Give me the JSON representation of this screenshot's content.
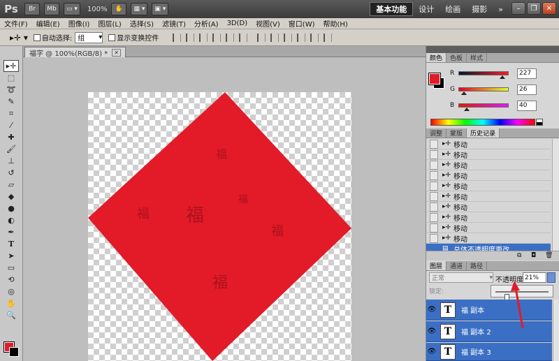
{
  "titlebar": {
    "app_logo": "Ps",
    "mode_btn1": "Br",
    "mode_btn2": "Mb",
    "zoom": "100%",
    "workspaces": [
      "基本功能",
      "设计",
      "绘画",
      "摄影"
    ],
    "more": "»"
  },
  "menu": [
    "文件(F)",
    "编辑(E)",
    "图像(I)",
    "图层(L)",
    "选择(S)",
    "滤镜(T)",
    "分析(A)",
    "3D(D)",
    "视图(V)",
    "窗口(W)",
    "帮助(H)"
  ],
  "options": {
    "auto_select_label": "自动选择:",
    "auto_select_value": "组",
    "show_transform_label": "显示变换控件"
  },
  "document": {
    "tab_title": "福字 @ 100%(RGB/8) *",
    "fill_color": "#e31a28"
  },
  "color_panel": {
    "tabs": [
      "颜色",
      "色板",
      "样式"
    ],
    "r_label": "R",
    "g_label": "G",
    "b_label": "B",
    "r": 227,
    "g": 26,
    "b": 40,
    "r_text": "227",
    "g_text": "26",
    "b_text": "40",
    "foreground": "#e31a28",
    "background": "#000000"
  },
  "history_panel": {
    "tabs": [
      "调整",
      "蒙版",
      "历史记录"
    ],
    "items": [
      "移动",
      "移动",
      "移动",
      "移动",
      "移动",
      "移动",
      "移动",
      "移动",
      "移动",
      "移动"
    ],
    "selected_item": "总体不透明度更改"
  },
  "layers_panel": {
    "tabs": [
      "图层",
      "通道",
      "路径"
    ],
    "blend_mode": "正常",
    "opacity_label": "不透明度:",
    "opacity_text": "21%",
    "opacity": 21,
    "lock_label": "锁定:",
    "layers": [
      "福 副本",
      "福 副本 2",
      "福 副本 3"
    ],
    "layer_thumb": "T"
  }
}
